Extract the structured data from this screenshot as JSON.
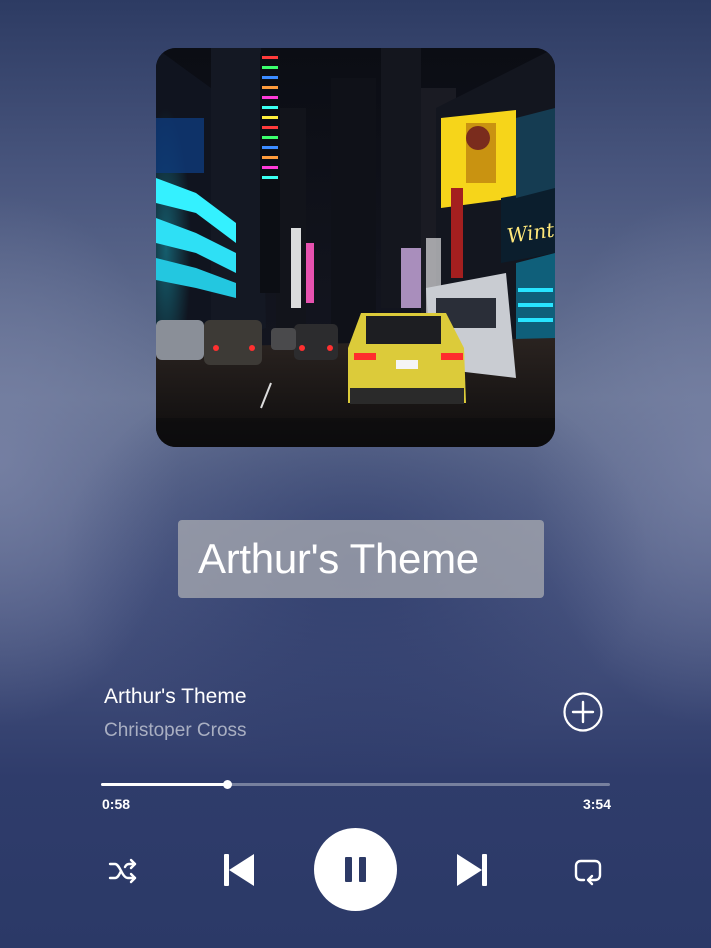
{
  "overlay_title": "Arthur's Theme",
  "track": {
    "title": "Arthur's Theme",
    "artist": "Christoper Cross"
  },
  "progress": {
    "elapsed": "0:58",
    "total": "3:54",
    "fraction": 0.248
  },
  "artwork": {
    "sign_text": "Winter G"
  },
  "controls": {
    "shuffle_icon": "shuffle-icon",
    "previous_icon": "skip-previous-icon",
    "play_pause_icon": "pause-icon",
    "next_icon": "skip-next-icon",
    "repeat_icon": "repeat-icon",
    "add_icon": "plus-circle-icon"
  },
  "colors": {
    "background_top": "#2d3b63",
    "background_mid": "#6a7696",
    "background_bottom": "#2b3967",
    "accent": "#ffffff",
    "artist_text": "#a9afc2"
  }
}
